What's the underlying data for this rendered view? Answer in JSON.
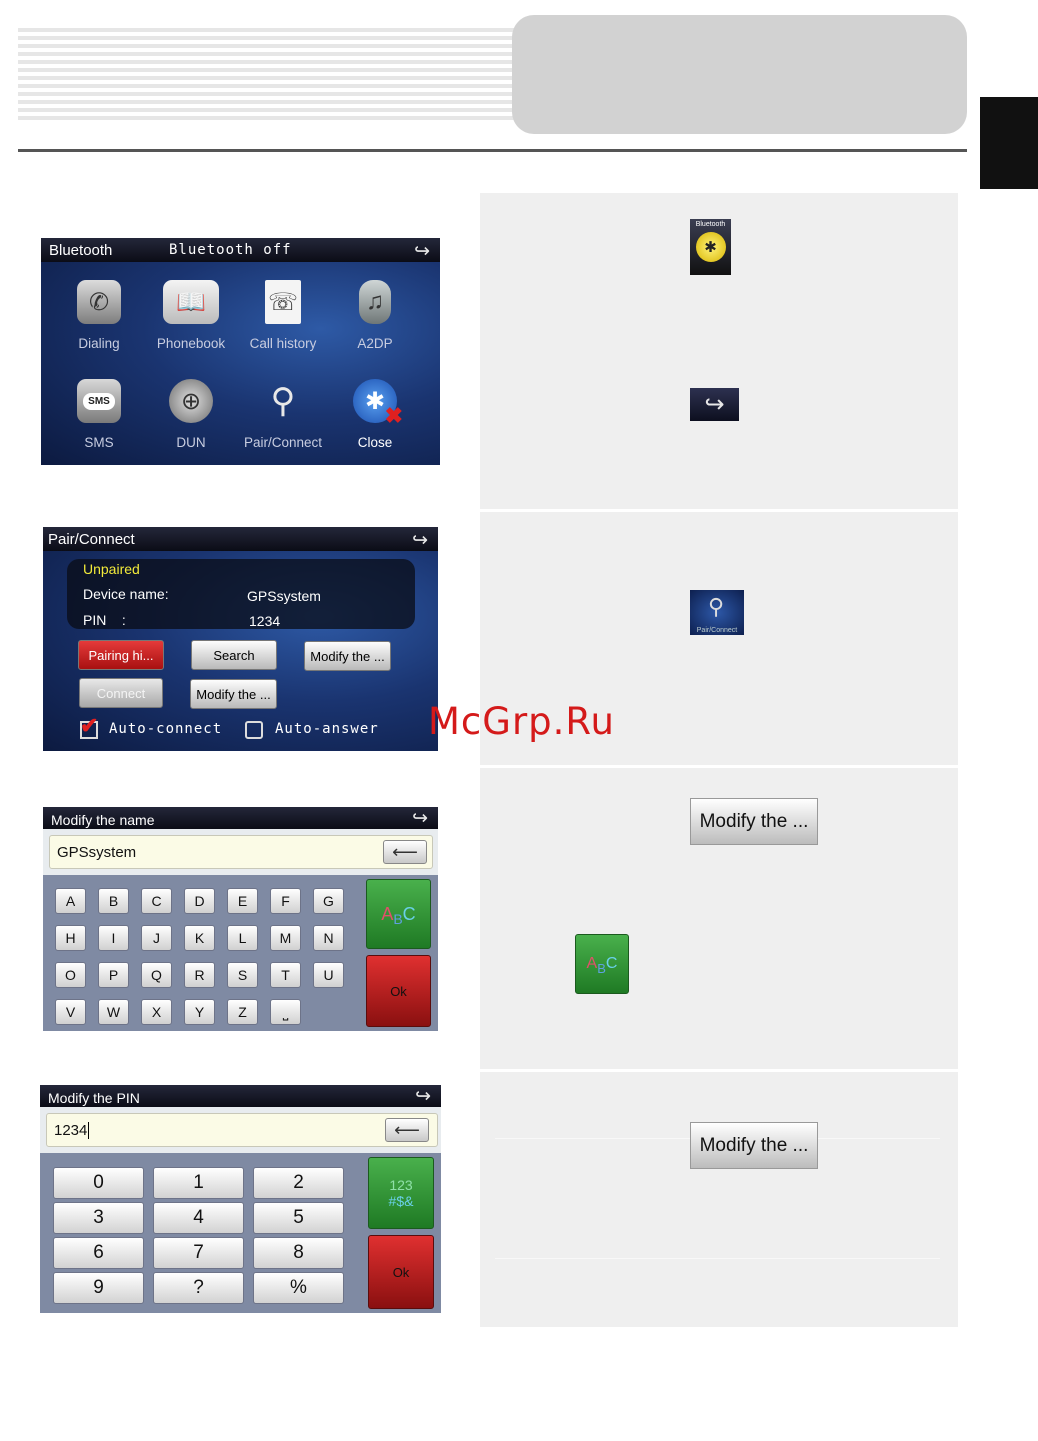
{
  "screen_bluetooth": {
    "title": "Bluetooth",
    "status": "Bluetooth off",
    "tiles": [
      {
        "label": "Dialing",
        "icon": "phone-icon"
      },
      {
        "label": "Phonebook",
        "icon": "phonebook-icon"
      },
      {
        "label": "Call history",
        "icon": "call-history-icon"
      },
      {
        "label": "A2DP",
        "icon": "a2dp-icon"
      },
      {
        "label": "SMS",
        "icon": "sms-icon"
      },
      {
        "label": "DUN",
        "icon": "dun-icon"
      },
      {
        "label": "Pair/Connect",
        "icon": "search-icon"
      },
      {
        "label": "Close",
        "icon": "bluetooth-close-icon"
      }
    ],
    "sms_icon_text": "SMS"
  },
  "screen_pair": {
    "title": "Pair/Connect",
    "state": "Unpaired",
    "device_label": "Device name:",
    "device_value": "GPSsystem",
    "pin_label": "PIN    :",
    "pin_value": "1234",
    "buttons": {
      "pairing": "Pairing hi...",
      "search": "Search",
      "modify1": "Modify the ...",
      "connect": "Connect",
      "modify2": "Modify the ..."
    },
    "auto_connect": "Auto-connect",
    "auto_answer": "Auto-answer"
  },
  "screen_name": {
    "title": "Modify the name",
    "value": "GPSsystem",
    "rows": [
      [
        "A",
        "B",
        "C",
        "D",
        "E",
        "F",
        "G"
      ],
      [
        "H",
        "I",
        "J",
        "K",
        "L",
        "M",
        "N"
      ],
      [
        "O",
        "P",
        "Q",
        "R",
        "S",
        "T",
        "U"
      ],
      [
        "V",
        "W",
        "X",
        "Y",
        "Z",
        "⎵"
      ]
    ],
    "abc_a": "A",
    "abc_b": "B",
    "abc_c": "C",
    "ok": "Ok"
  },
  "screen_pin": {
    "title": "Modify the PIN",
    "value": "1234",
    "keys": [
      "0",
      "1",
      "2",
      "3",
      "4",
      "5",
      "6",
      "7",
      "8",
      "9",
      "?",
      "%"
    ],
    "mode_line1": "123",
    "mode_line2": "#$&",
    "ok": "Ok"
  },
  "right_panel": {
    "bt_icon_label": "Bluetooth",
    "pair_icon_label": "Pair/Connect",
    "modify_button_1": "Modify the ...",
    "modify_button_2": "Modify the ...",
    "abc_a": "A",
    "abc_b": "B",
    "abc_c": "C"
  },
  "watermark": "McGrp.Ru",
  "colors": {
    "green": "#2e9a34",
    "red": "#c01818",
    "yellow": "#f2ea3a",
    "screen": "#1a3470"
  }
}
